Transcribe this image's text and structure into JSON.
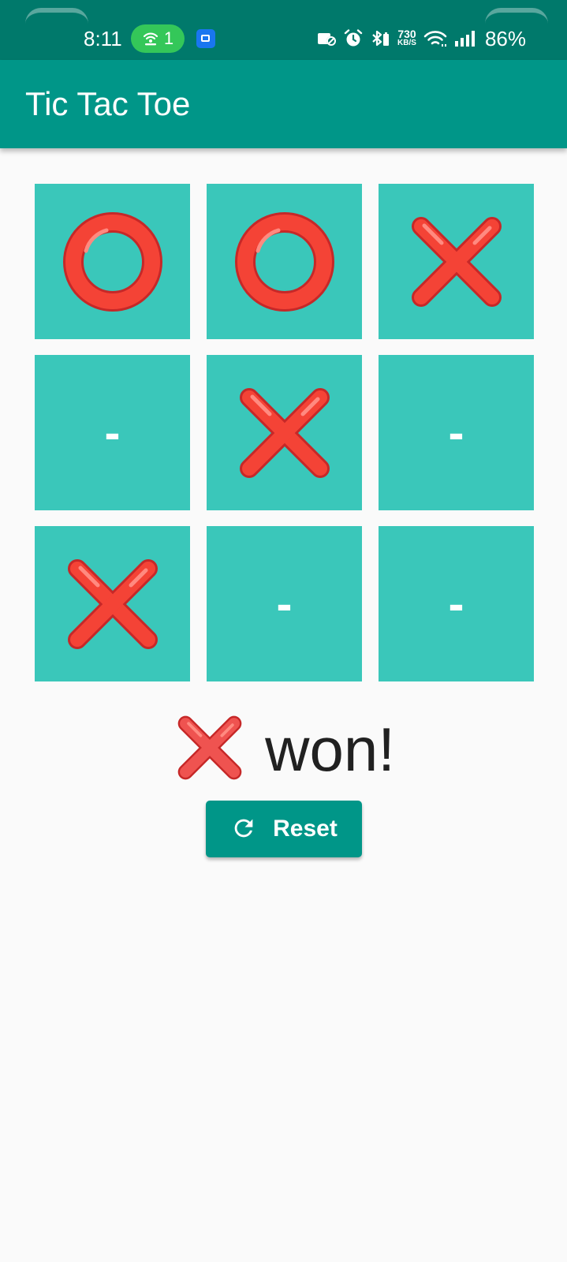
{
  "status_bar": {
    "time": "8:11",
    "hotspot_count": "1",
    "net_speed_value": "730",
    "net_speed_unit": "KB/S",
    "battery": "86%",
    "icons": [
      "hotspot-icon",
      "notification-app-icon",
      "no-sim-icon",
      "alarm-icon",
      "bluetooth-icon",
      "wifi-icon",
      "signal-icon"
    ]
  },
  "app_bar": {
    "title": "Tic Tac Toe"
  },
  "board": {
    "cells": [
      {
        "value": "O",
        "text": ""
      },
      {
        "value": "O",
        "text": ""
      },
      {
        "value": "X",
        "text": ""
      },
      {
        "value": "",
        "text": "-"
      },
      {
        "value": "X",
        "text": ""
      },
      {
        "value": "",
        "text": "-"
      },
      {
        "value": "X",
        "text": ""
      },
      {
        "value": "",
        "text": "-"
      },
      {
        "value": "",
        "text": "-"
      }
    ]
  },
  "result": {
    "winner_icon": "red-x-icon",
    "text": "won!"
  },
  "reset_button": {
    "label": "Reset",
    "icon": "refresh-icon"
  },
  "colors": {
    "status_bar": "#00796b",
    "app_bar": "#009688",
    "cell": "#3ac7ba",
    "mark": "#f44336",
    "background": "#fafafa"
  }
}
